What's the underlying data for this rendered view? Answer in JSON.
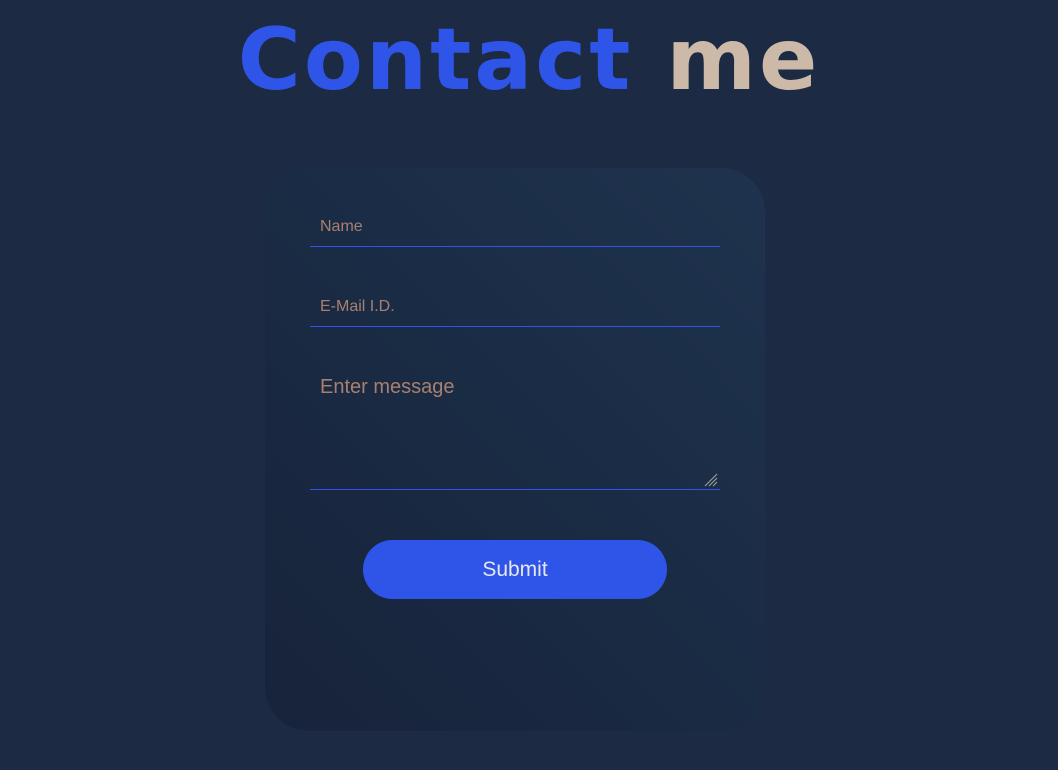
{
  "heading": {
    "accent": "Contact",
    "rest": "me"
  },
  "form": {
    "name_placeholder": "Name",
    "email_placeholder": "E-Mail I.D.",
    "message_placeholder": "Enter message",
    "submit_label": "Submit"
  },
  "colors": {
    "background": "#1c2b43",
    "accent": "#2f55e8",
    "heading_secondary": "#cdb9a8",
    "placeholder": "#a8806f"
  },
  "icons": {
    "resize": "resize-grip-icon"
  }
}
